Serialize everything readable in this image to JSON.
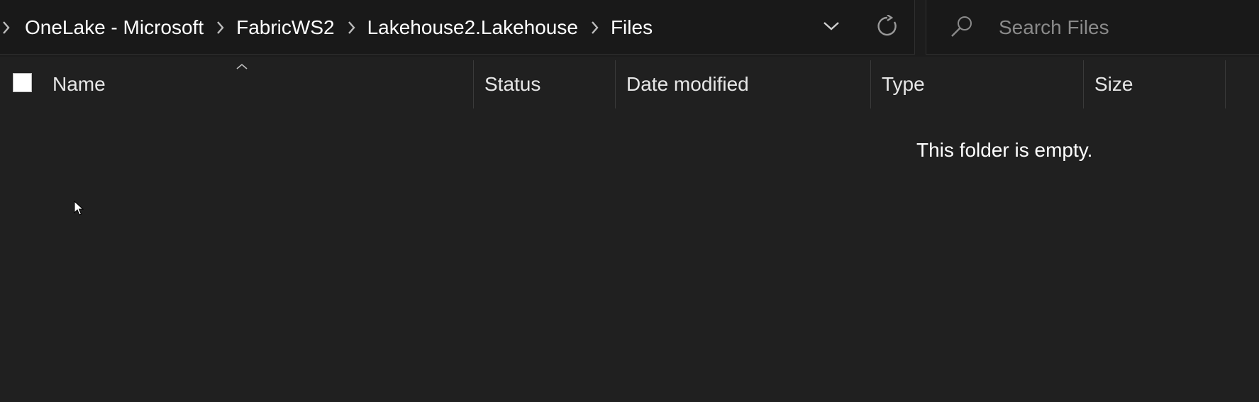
{
  "breadcrumb": {
    "items": [
      {
        "label": "OneLake - Microsoft"
      },
      {
        "label": "FabricWS2"
      },
      {
        "label": "Lakehouse2.Lakehouse"
      },
      {
        "label": "Files"
      }
    ]
  },
  "search": {
    "placeholder": "Search Files"
  },
  "columns": {
    "name": "Name",
    "status": "Status",
    "date_modified": "Date modified",
    "type": "Type",
    "size": "Size"
  },
  "content": {
    "empty_message": "This folder is empty."
  },
  "colors": {
    "background": "#202020",
    "address_bar": "#191919",
    "text": "#ffffff",
    "placeholder": "#8a8a8a"
  },
  "icons": [
    "chevron-right-icon",
    "chevron-down-icon",
    "refresh-icon",
    "search-icon",
    "sort-up-icon",
    "mouse-cursor-icon"
  ]
}
